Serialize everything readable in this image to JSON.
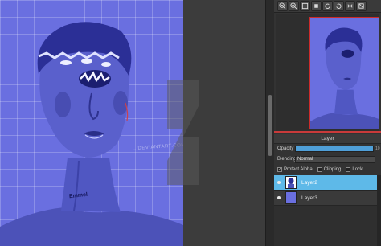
{
  "canvas": {
    "signature": "Emmel",
    "watermark": "...DEVIANTART.COM"
  },
  "navigator_toolbar": {
    "buttons": [
      "zoom-out-icon",
      "zoom-in-icon",
      "fit-icon",
      "actual-size-icon",
      "rotate-left-icon",
      "rotate-right-icon",
      "flip-icon",
      "reset-icon"
    ]
  },
  "layer_panel": {
    "title": "Layer",
    "opacity_label": "Opacity",
    "opacity_percent": 100,
    "opacity_value": "10",
    "blending_label": "Blending",
    "blending_value": "Normal",
    "protect_alpha_label": "Protect Alpha",
    "protect_alpha_checked": true,
    "clipping_label": "Clipping",
    "clipping_checked": false,
    "lock_label": "Lock",
    "lock_checked": false,
    "layers": [
      {
        "name": "Layer2",
        "selected": true,
        "visible": true
      },
      {
        "name": "Layer3",
        "selected": false,
        "visible": true
      }
    ]
  },
  "colors": {
    "canvas_bg": "#6a6fe0",
    "accent": "#5eb9e8",
    "nav_frame": "#cc2b2b"
  }
}
